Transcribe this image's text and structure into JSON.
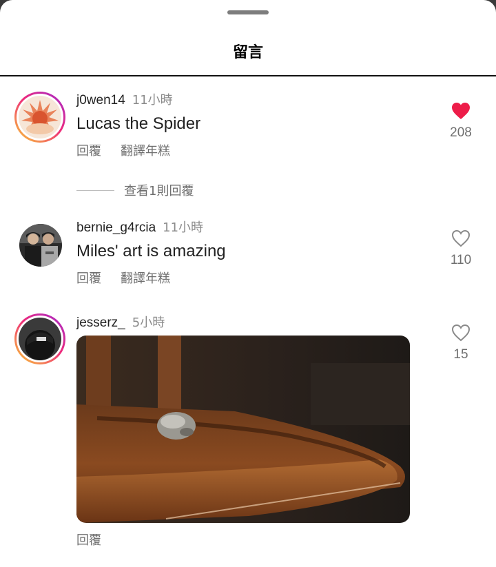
{
  "sheet": {
    "title": "留言"
  },
  "comments": [
    {
      "username": "j0wen14",
      "time": "11小時",
      "text": "Lucas the Spider",
      "actions": {
        "reply": "回覆",
        "translate": "翻譯年糕"
      },
      "likes": "208",
      "liked": true,
      "avatar_ring": true,
      "view_replies": "查看1則回覆"
    },
    {
      "username": "bernie_g4rcia",
      "time": "11小時",
      "text": "Miles' art is amazing",
      "actions": {
        "reply": "回覆",
        "translate": "翻譯年糕"
      },
      "likes": "110",
      "liked": false,
      "avatar_ring": false
    },
    {
      "username": "jesserz_",
      "time": "5小時",
      "media": "gif-image",
      "actions": {
        "reply": "回覆"
      },
      "likes": "15",
      "liked": false,
      "avatar_ring": true
    }
  ],
  "colors": {
    "like_active": "#ed1d49",
    "like_inactive": "#8a8a8a",
    "muted_text": "#6f6f6f"
  },
  "icons": {
    "like_filled": "heart-filled-icon",
    "like_outline": "heart-outline-icon"
  }
}
